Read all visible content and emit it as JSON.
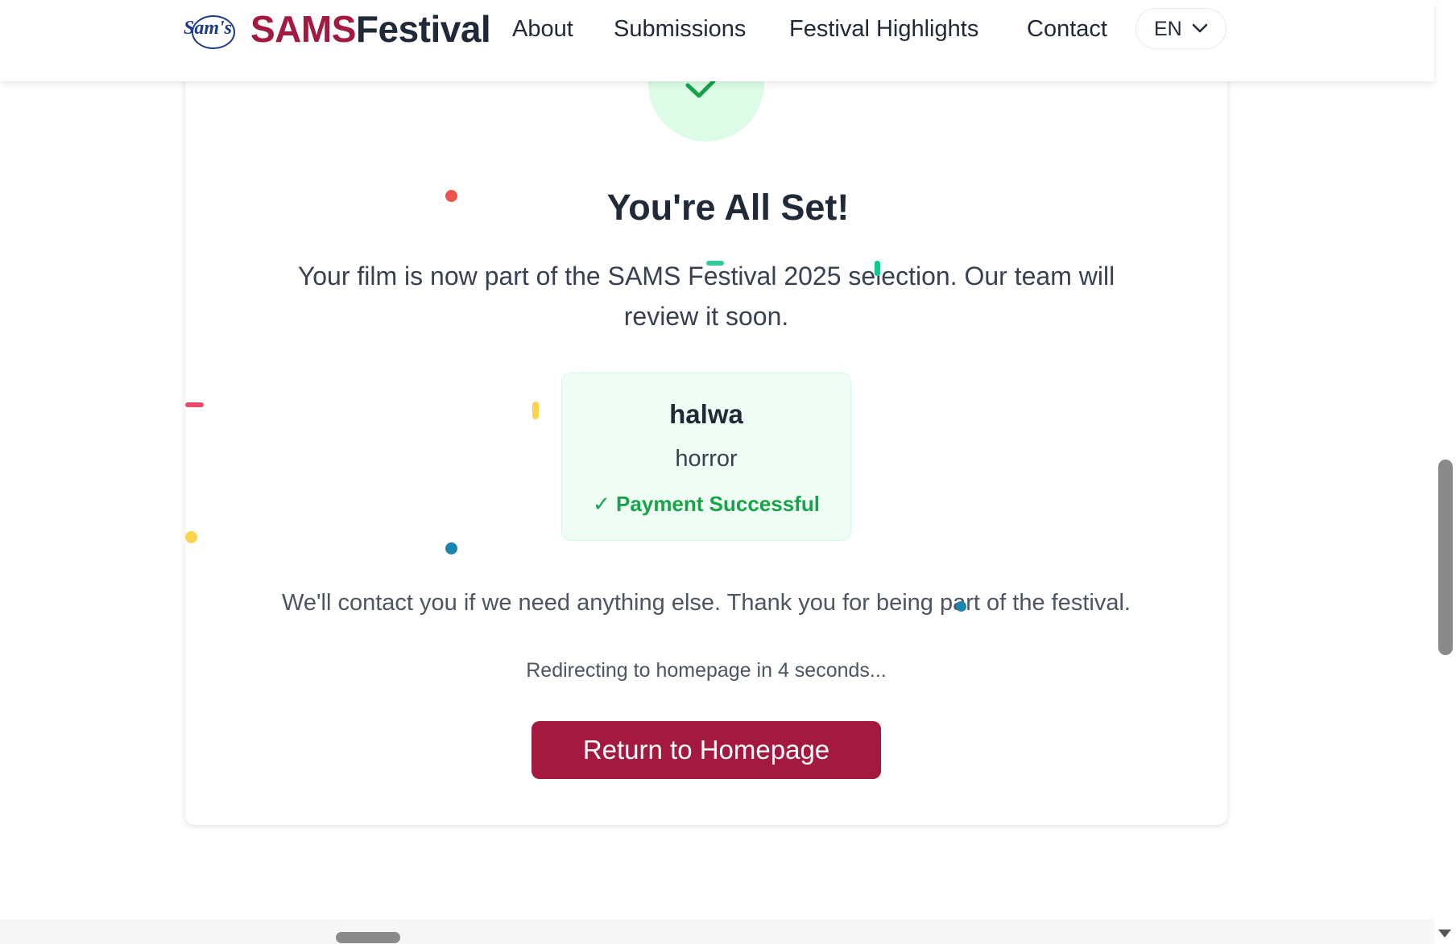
{
  "header": {
    "brand_part1": "SAMS",
    "brand_part2": "Festival",
    "logo_icon": "sams-studios-logo-icon",
    "nav": [
      "About",
      "Submissions",
      "Festival Highlights",
      "Contact"
    ],
    "language": "EN"
  },
  "confirmation": {
    "title": "You're All Set!",
    "subtitle": "Your film is now part of the SAMS Festival 2025 selection. Our team will review it soon.",
    "film": {
      "title": "halwa",
      "genre": "horror",
      "status": "✓ Payment Successful"
    },
    "contact_message": "We'll contact you if we need anything else. Thank you for being part of the festival.",
    "redirect_message": "Redirecting to homepage in 4 seconds...",
    "return_button": "Return to Homepage"
  },
  "colors": {
    "brand": "#a3193f",
    "success": "#16a34a",
    "success_bg": "#dcfce7"
  }
}
